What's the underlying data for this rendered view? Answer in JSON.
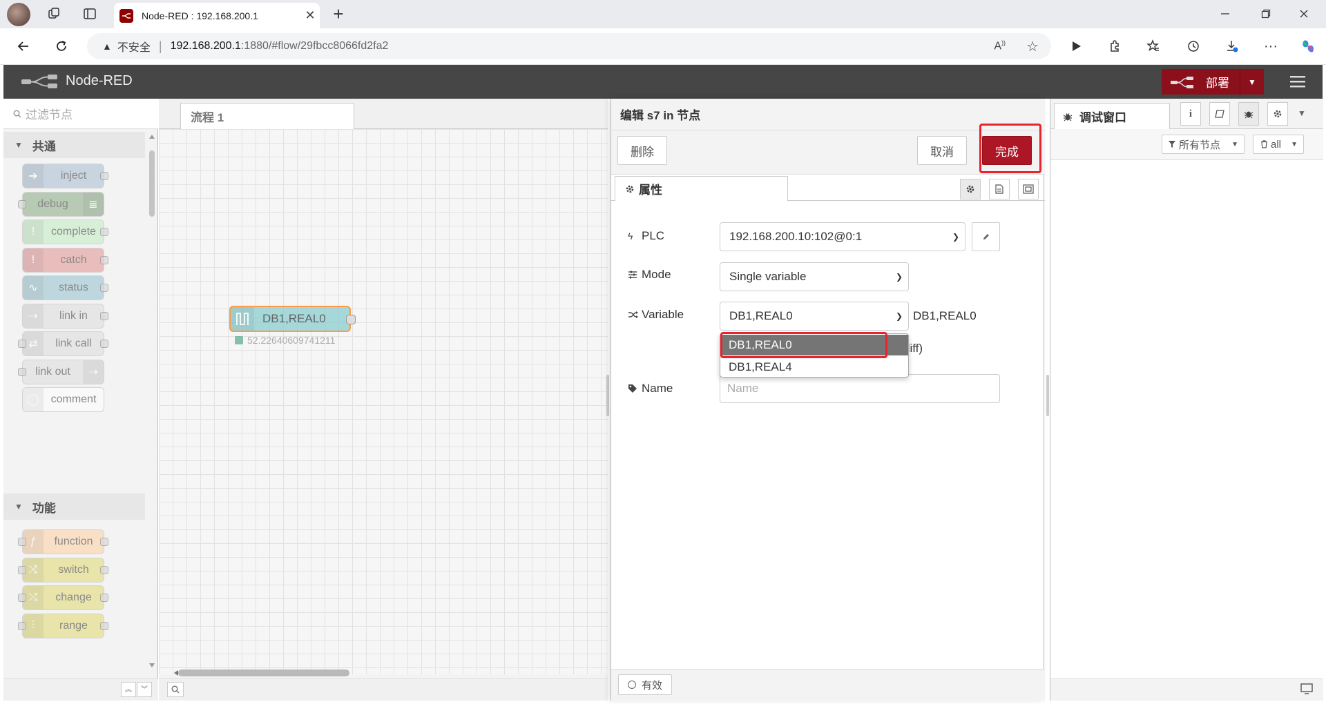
{
  "browser": {
    "tab_title": "Node-RED : 192.168.200.1",
    "insecure_label": "不安全",
    "url_host": "192.168.200.1",
    "url_path": ":1880/#flow/29fbcc8066fd2fa2"
  },
  "header": {
    "app_name": "Node-RED",
    "deploy_label": "部署"
  },
  "palette": {
    "search_placeholder": "过滤节点",
    "categories": [
      {
        "label": "共通"
      },
      {
        "label": "功能"
      }
    ],
    "common_nodes": [
      {
        "label": "inject",
        "color": "#a6bbcf"
      },
      {
        "label": "debug",
        "color": "#87a980"
      },
      {
        "label": "complete",
        "color": "#c0edc0"
      },
      {
        "label": "catch",
        "color": "#e49191"
      },
      {
        "label": "status",
        "color": "#94c1d0"
      },
      {
        "label": "link in",
        "color": "#dddddd"
      },
      {
        "label": "link call",
        "color": "#dddddd"
      },
      {
        "label": "link out",
        "color": "#dddddd"
      },
      {
        "label": "comment",
        "color": "#ffffff"
      }
    ],
    "function_nodes": [
      {
        "label": "function",
        "color": "#fdd0a2"
      },
      {
        "label": "switch",
        "color": "#e2d96e"
      },
      {
        "label": "change",
        "color": "#e2d96e"
      },
      {
        "label": "range",
        "color": "#e2d96e"
      }
    ]
  },
  "workspace": {
    "flow_tab": "流程 1",
    "node_label": "DB1,REAL0",
    "node_status": "52.22640609741211"
  },
  "editor": {
    "title": "编辑 s7 in 节点",
    "delete_label": "删除",
    "cancel_label": "取消",
    "done_label": "完成",
    "properties_tab": "属性",
    "plc_label": "PLC",
    "plc_value": "192.168.200.10:102@0:1",
    "mode_label": "Mode",
    "mode_value": "Single variable",
    "variable_label": "Variable",
    "variable_value": "DB1,REAL0",
    "variable_side_text": "DB1,REAL0",
    "diff_fragment": "diff)",
    "variable_options": [
      "DB1,REAL0",
      "DB1,REAL4"
    ],
    "name_label": "Name",
    "name_placeholder": "Name",
    "enabled_label": "有效"
  },
  "sidebar": {
    "debug_tab": "调试窗口",
    "filter_label": "所有节点",
    "clear_label": "all"
  },
  "colors": {
    "deploy_bg": "#8c101c",
    "done_bg": "#ad1625",
    "highlight": "#e8232b",
    "header_bg": "#464646"
  }
}
